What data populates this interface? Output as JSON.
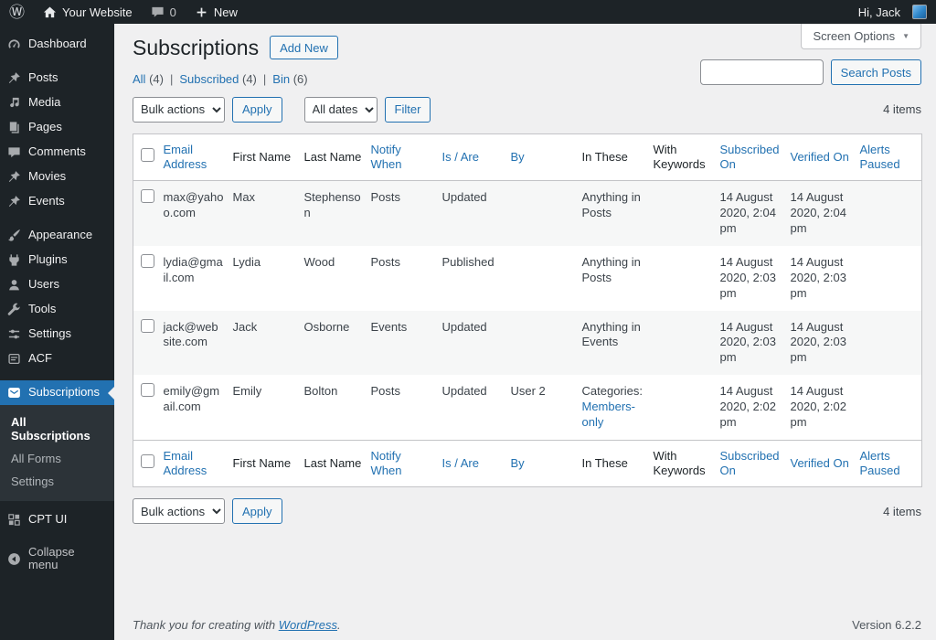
{
  "admin_bar": {
    "site_name": "Your Website",
    "comments_count": "0",
    "new_label": "New",
    "greeting": "Hi, Jack"
  },
  "sidebar": {
    "items": [
      {
        "label": "Dashboard",
        "icon": "dashboard-icon"
      },
      {
        "label": "Posts",
        "icon": "pin-icon"
      },
      {
        "label": "Media",
        "icon": "media-icon"
      },
      {
        "label": "Pages",
        "icon": "pages-icon"
      },
      {
        "label": "Comments",
        "icon": "comments-icon"
      },
      {
        "label": "Movies",
        "icon": "pin-icon"
      },
      {
        "label": "Events",
        "icon": "pin-icon"
      },
      {
        "label": "Appearance",
        "icon": "appearance-icon"
      },
      {
        "label": "Plugins",
        "icon": "plugins-icon"
      },
      {
        "label": "Users",
        "icon": "users-icon"
      },
      {
        "label": "Tools",
        "icon": "tools-icon"
      },
      {
        "label": "Settings",
        "icon": "settings-icon"
      },
      {
        "label": "ACF",
        "icon": "acf-icon"
      },
      {
        "label": "Subscriptions",
        "icon": "subscriptions-icon"
      },
      {
        "label": "CPT UI",
        "icon": "cptui-icon"
      }
    ],
    "active_item": "Subscriptions",
    "submenu": [
      "All Subscriptions",
      "All Forms",
      "Settings"
    ],
    "active_submenu": "All Subscriptions",
    "collapse_label": "Collapse menu"
  },
  "header": {
    "title": "Subscriptions",
    "add_new_label": "Add New",
    "screen_options_label": "Screen Options"
  },
  "icons": {
    "dropdown_arrow": "▼"
  },
  "filters": {
    "separator": "|",
    "views": [
      {
        "label": "All",
        "count": "(4)"
      },
      {
        "label": "Subscribed",
        "count": "(4)"
      },
      {
        "label": "Bin",
        "count": "(6)"
      }
    ]
  },
  "toolbar": {
    "bulk_actions_label": "Bulk actions",
    "apply_label": "Apply",
    "dates_label": "All dates",
    "filter_label": "Filter",
    "search_button_label": "Search Posts",
    "items_count": "4 items"
  },
  "table": {
    "columns": [
      {
        "label": "Email Address",
        "sortable": true
      },
      {
        "label": "First Name",
        "sortable": false
      },
      {
        "label": "Last Name",
        "sortable": false
      },
      {
        "label": "Notify When",
        "sortable": true
      },
      {
        "label": "Is / Are",
        "sortable": true
      },
      {
        "label": "By",
        "sortable": true
      },
      {
        "label": "In These",
        "sortable": false
      },
      {
        "label": "With Keywords",
        "sortable": false
      },
      {
        "label": "Subscribed On",
        "sortable": true
      },
      {
        "label": "Verified On",
        "sortable": true
      },
      {
        "label": "Alerts Paused",
        "sortable": true
      }
    ],
    "rows": [
      {
        "cells": [
          "max@yahoo.com",
          "Max",
          "Stephenson",
          "Posts",
          "Updated",
          "",
          "Anything in Posts",
          "",
          "14 August 2020, 2:04 pm",
          "14 August 2020, 2:04 pm",
          ""
        ]
      },
      {
        "cells": [
          "lydia@gmail.com",
          "Lydia",
          "Wood",
          "Posts",
          "Published",
          "",
          "Anything in Posts",
          "",
          "14 August 2020, 2:03 pm",
          "14 August 2020, 2:03 pm",
          ""
        ]
      },
      {
        "cells": [
          "jack@website.com",
          "Jack",
          "Osborne",
          "Events",
          "Updated",
          "",
          "Anything in Events",
          "",
          "14 August 2020, 2:03 pm",
          "14 August 2020, 2:03 pm",
          ""
        ]
      },
      {
        "cells": [
          "emily@gmail.com",
          "Emily",
          "Bolton",
          "Posts",
          "Updated",
          "User 2",
          {
            "text": "Categories:",
            "link": "Members-only"
          },
          "",
          "14 August 2020, 2:02 pm",
          "14 August 2020, 2:02 pm",
          ""
        ]
      }
    ]
  },
  "footer": {
    "thanks_prefix": "Thank you for creating with ",
    "wordpress_link": "WordPress",
    "thanks_suffix": ".",
    "version": "Version 6.2.2"
  },
  "colors": {
    "accent": "#2271b1",
    "admin_bar_bg": "#1d2327",
    "sidebar_bg": "#1d2327",
    "submenu_bg": "#2c3338",
    "content_bg": "#f0f0f1",
    "table_border": "#c3c4c7",
    "row_alt_bg": "#f6f7f7",
    "text": "#3c434a"
  }
}
